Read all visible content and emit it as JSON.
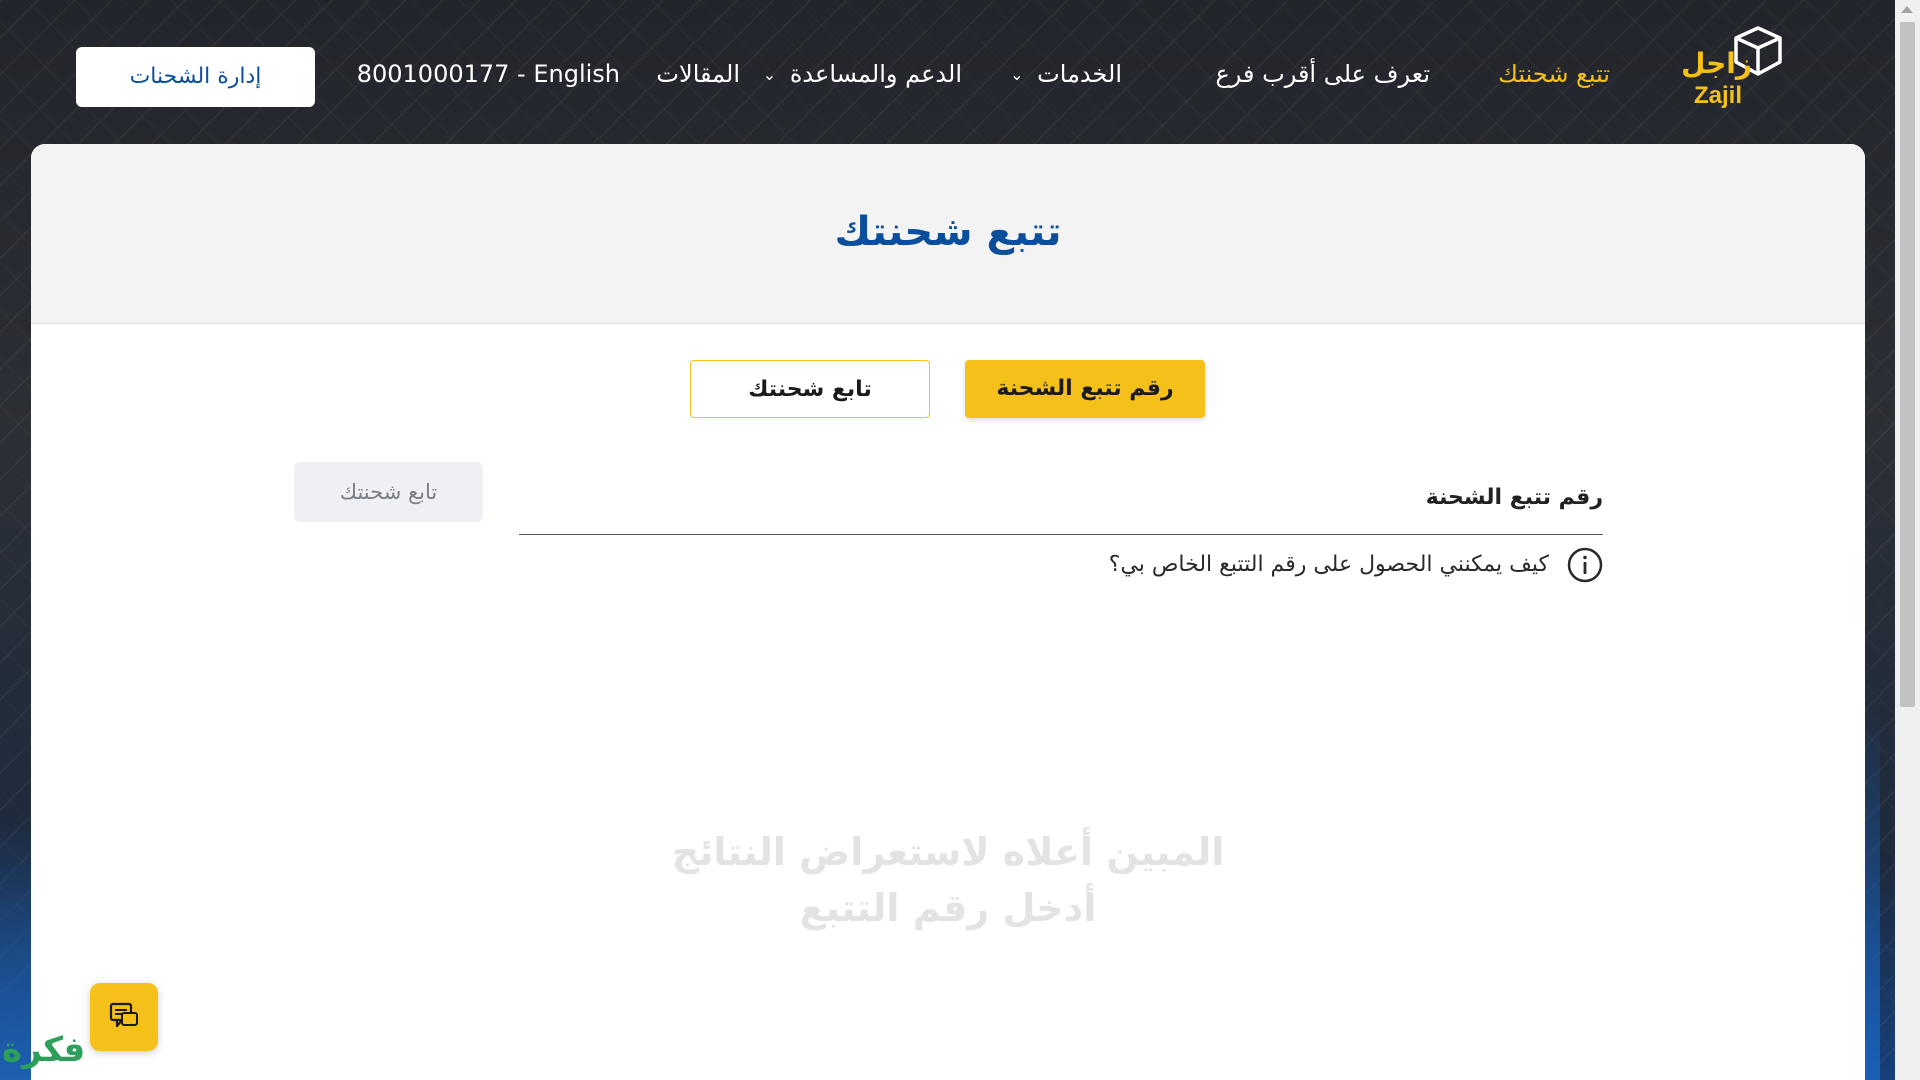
{
  "header": {
    "logo": {
      "ar": "زاجل",
      "en": "Zajil",
      "icon": "box-icon"
    },
    "nav": [
      {
        "label": "تتبع شحنتك",
        "active": true,
        "dropdown": false
      },
      {
        "label": "تعرف على أقرب فرع",
        "active": false,
        "dropdown": false
      },
      {
        "label": "الخدمات",
        "active": false,
        "dropdown": true
      },
      {
        "label": "الدعم والمساعدة",
        "active": false,
        "dropdown": true
      },
      {
        "label": "المقالات",
        "active": false,
        "dropdown": false
      },
      {
        "label": "8001000177 - English",
        "active": false,
        "dropdown": false
      }
    ],
    "manage_button": "إدارة الشحنات"
  },
  "page": {
    "title": "تتبع شحنتك",
    "tabs": [
      {
        "label": "رقم تتبع الشحنة",
        "active": true
      },
      {
        "label": "تابع شحنتك",
        "active": false
      }
    ],
    "tracking_input": {
      "placeholder": "رقم تتبع الشحنة",
      "value": ""
    },
    "track_button": "تابع شحنتك",
    "help_text": "كيف يمكنني الحصول على رقم التتبع الخاص بي؟",
    "empty_state": {
      "line1": "المبين أعلاه لاستعراض النتائج",
      "line2": "أدخل رقم التتبع"
    }
  },
  "widgets": {
    "chat_icon": "chat-icon",
    "watermark": "فكرة"
  },
  "colors": {
    "accent": "#f4c019",
    "brand_blue": "#0b4f9c",
    "header_bg": "#22252b"
  }
}
